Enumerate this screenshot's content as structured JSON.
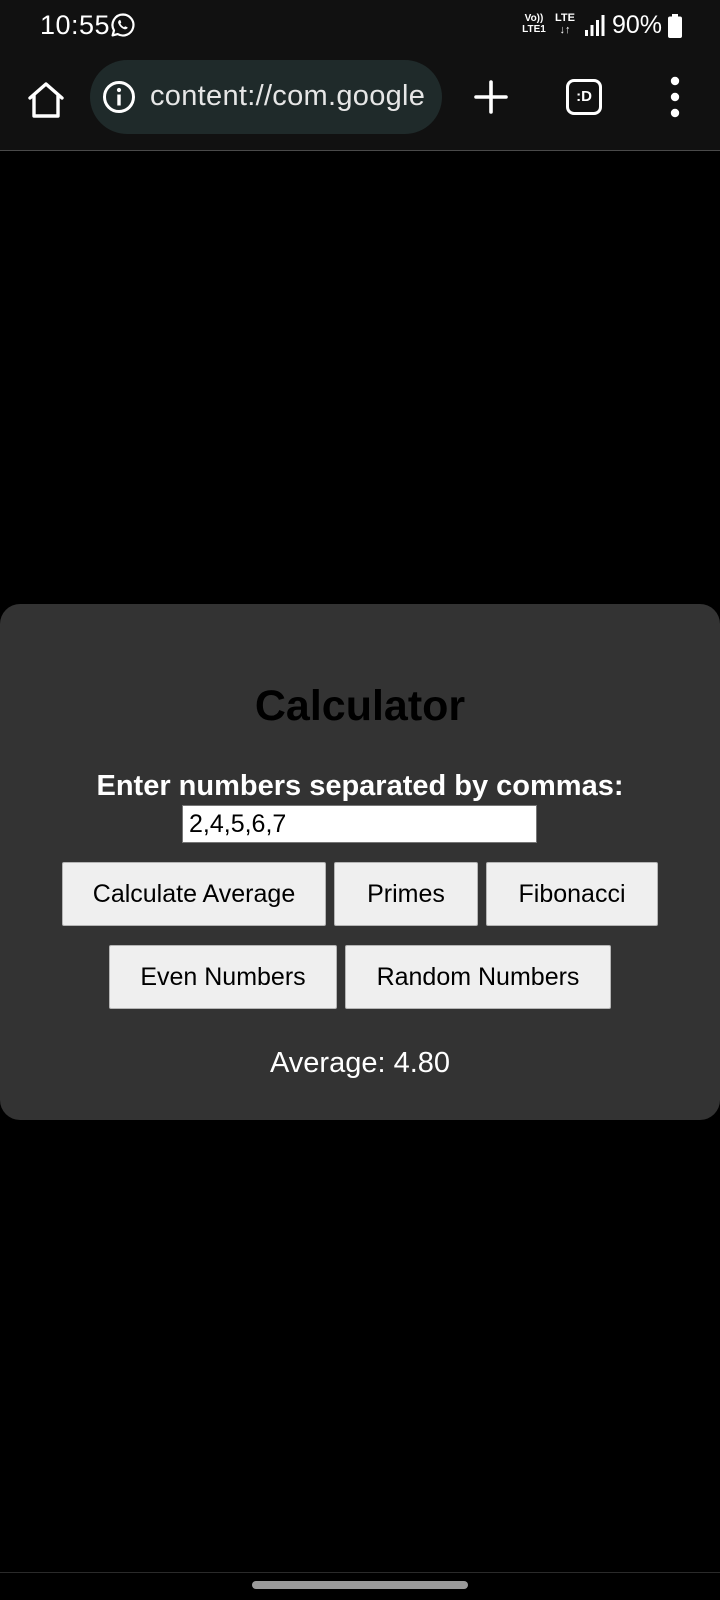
{
  "status_bar": {
    "time": "10:55",
    "volte_top": "Vo))",
    "volte_bottom": "LTE1",
    "lte_label": "LTE",
    "lte_arrows": "↓↑",
    "battery_percent": "90%",
    "icons": [
      "whatsapp-icon",
      "volte-icon",
      "lte-icon",
      "signal-icon",
      "battery-icon"
    ]
  },
  "browser": {
    "url": "content://com.google",
    "tab_count_label": ":D",
    "icons": [
      "home-icon",
      "info-icon",
      "plus-icon",
      "tabs-icon",
      "more-vert-icon"
    ]
  },
  "calculator": {
    "title": "Calculator",
    "prompt": "Enter numbers separated by commas:",
    "input_value": "2,4,5,6,7",
    "buttons": {
      "average": "Calculate Average",
      "primes": "Primes",
      "fibonacci": "Fibonacci",
      "even": "Even Numbers",
      "random": "Random Numbers"
    },
    "result": "Average: 4.80"
  },
  "colors": {
    "page_background": "#000000",
    "bar_background": "#111111",
    "url_bar_background": "#1f2a2a",
    "card_background": "#333333",
    "button_background": "#efefef"
  }
}
